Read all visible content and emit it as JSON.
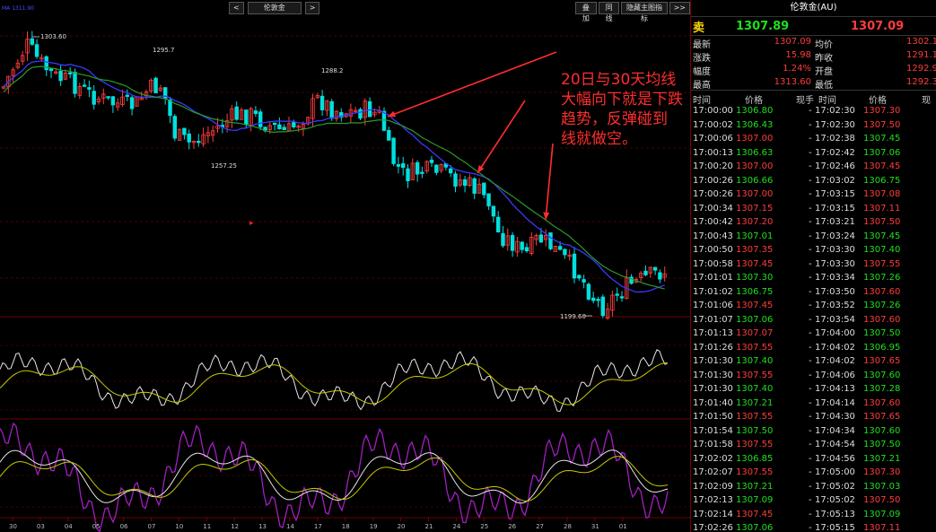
{
  "toolbar": {
    "prev_label": "<",
    "symbol_label": "伦敦金",
    "next_label": ">",
    "overlay_label": "叠加",
    "sync_label": "同线",
    "hide_indicators_label": "隐藏主图指标",
    "expand_label": ">>"
  },
  "main_chart": {
    "indicator_tag": "MA 1311.90",
    "high_label": "1303.60",
    "label_1": "1295.7",
    "label_2": "1288.2",
    "label_3": "1257.25",
    "low_label": "1199.60",
    "marker_glyph": "▸"
  },
  "annotation": {
    "lines": [
      "20日与30天均线",
      "大幅向下就是下跌",
      "趋势，反弹碰到",
      "线就做空。"
    ]
  },
  "x_axis_labels": [
    "30",
    "03",
    "04",
    "05",
    "06",
    "07",
    "10",
    "11",
    "12",
    "13",
    "14",
    "17",
    "18",
    "19",
    "20",
    "21",
    "24",
    "25",
    "26",
    "27",
    "28",
    "31",
    "01"
  ],
  "colors": {
    "up": "#ff3c3c",
    "down": "#00e0e0",
    "ma_blue": "#3a3aff",
    "ma_green": "#2a9a2a",
    "osc_white": "#e6e6e6",
    "osc_yellow": "#c8c800",
    "osc_purple": "#a020c0",
    "price_up": "#ff3c3c",
    "price_down": "#1ee01e",
    "annotation": "#ff2d2d"
  },
  "quote": {
    "title": "伦敦金(AU)",
    "sell_label": "卖",
    "sell_price": "1307.89",
    "buy_price": "1307.09",
    "stats": [
      {
        "l1": "最新",
        "v1": "1307.09",
        "l2": "均价",
        "v2": "1302.1"
      },
      {
        "l1": "涨跌",
        "v1": "15.98",
        "l2": "昨收",
        "v2": "1291.1"
      },
      {
        "l1": "幅度",
        "v1": "1.24%",
        "l2": "开盘",
        "v2": "1292.9"
      },
      {
        "l1": "最高",
        "v1": "1313.60",
        "l2": "最低",
        "v2": "1292.3"
      }
    ],
    "table_headers": {
      "time": "时间",
      "price": "价格",
      "vol": "现手",
      "time2": "时间",
      "price2": "价格",
      "vol2": "现"
    },
    "ticks": [
      {
        "t1": "17:00:00",
        "p1": "1306.80",
        "c1": "g",
        "t2": "17:02:30",
        "p2": "1307.30",
        "c2": "r"
      },
      {
        "t1": "17:00:02",
        "p1": "1306.43",
        "c1": "g",
        "t2": "17:02:30",
        "p2": "1307.50",
        "c2": "r"
      },
      {
        "t1": "17:00:06",
        "p1": "1307.00",
        "c1": "r",
        "t2": "17:02:38",
        "p2": "1307.45",
        "c2": "g"
      },
      {
        "t1": "17:00:13",
        "p1": "1306.63",
        "c1": "g",
        "t2": "17:02:42",
        "p2": "1307.06",
        "c2": "g"
      },
      {
        "t1": "17:00:20",
        "p1": "1307.00",
        "c1": "r",
        "t2": "17:02:46",
        "p2": "1307.45",
        "c2": "r"
      },
      {
        "t1": "17:00:26",
        "p1": "1306.66",
        "c1": "g",
        "t2": "17:03:02",
        "p2": "1306.75",
        "c2": "g"
      },
      {
        "t1": "17:00:26",
        "p1": "1307.00",
        "c1": "r",
        "t2": "17:03:15",
        "p2": "1307.08",
        "c2": "r"
      },
      {
        "t1": "17:00:34",
        "p1": "1307.15",
        "c1": "r",
        "t2": "17:03:15",
        "p2": "1307.11",
        "c2": "r"
      },
      {
        "t1": "17:00:42",
        "p1": "1307.20",
        "c1": "r",
        "t2": "17:03:21",
        "p2": "1307.50",
        "c2": "r"
      },
      {
        "t1": "17:00:43",
        "p1": "1307.01",
        "c1": "g",
        "t2": "17:03:24",
        "p2": "1307.45",
        "c2": "g"
      },
      {
        "t1": "17:00:50",
        "p1": "1307.35",
        "c1": "r",
        "t2": "17:03:30",
        "p2": "1307.40",
        "c2": "g"
      },
      {
        "t1": "17:00:58",
        "p1": "1307.45",
        "c1": "r",
        "t2": "17:03:30",
        "p2": "1307.55",
        "c2": "r"
      },
      {
        "t1": "17:01:01",
        "p1": "1307.30",
        "c1": "g",
        "t2": "17:03:34",
        "p2": "1307.26",
        "c2": "g"
      },
      {
        "t1": "17:01:02",
        "p1": "1306.75",
        "c1": "g",
        "t2": "17:03:50",
        "p2": "1307.60",
        "c2": "r"
      },
      {
        "t1": "17:01:06",
        "p1": "1307.45",
        "c1": "r",
        "t2": "17:03:52",
        "p2": "1307.26",
        "c2": "g"
      },
      {
        "t1": "17:01:07",
        "p1": "1307.06",
        "c1": "g",
        "t2": "17:03:54",
        "p2": "1307.60",
        "c2": "r"
      },
      {
        "t1": "17:01:13",
        "p1": "1307.07",
        "c1": "r",
        "t2": "17:04:00",
        "p2": "1307.50",
        "c2": "g"
      },
      {
        "t1": "17:01:26",
        "p1": "1307.55",
        "c1": "r",
        "t2": "17:04:02",
        "p2": "1306.95",
        "c2": "g"
      },
      {
        "t1": "17:01:30",
        "p1": "1307.40",
        "c1": "g",
        "t2": "17:04:02",
        "p2": "1307.65",
        "c2": "r"
      },
      {
        "t1": "17:01:30",
        "p1": "1307.55",
        "c1": "r",
        "t2": "17:04:06",
        "p2": "1307.60",
        "c2": "g"
      },
      {
        "t1": "17:01:30",
        "p1": "1307.40",
        "c1": "g",
        "t2": "17:04:13",
        "p2": "1307.28",
        "c2": "g"
      },
      {
        "t1": "17:01:40",
        "p1": "1307.21",
        "c1": "g",
        "t2": "17:04:14",
        "p2": "1307.60",
        "c2": "r"
      },
      {
        "t1": "17:01:50",
        "p1": "1307.55",
        "c1": "r",
        "t2": "17:04:30",
        "p2": "1307.65",
        "c2": "r"
      },
      {
        "t1": "17:01:54",
        "p1": "1307.50",
        "c1": "g",
        "t2": "17:04:34",
        "p2": "1307.60",
        "c2": "g"
      },
      {
        "t1": "17:01:58",
        "p1": "1307.55",
        "c1": "r",
        "t2": "17:04:54",
        "p2": "1307.50",
        "c2": "g"
      },
      {
        "t1": "17:02:02",
        "p1": "1306.85",
        "c1": "g",
        "t2": "17:04:56",
        "p2": "1307.21",
        "c2": "g"
      },
      {
        "t1": "17:02:07",
        "p1": "1307.55",
        "c1": "r",
        "t2": "17:05:00",
        "p2": "1307.30",
        "c2": "r"
      },
      {
        "t1": "17:02:09",
        "p1": "1307.21",
        "c1": "g",
        "t2": "17:05:02",
        "p2": "1307.03",
        "c2": "g"
      },
      {
        "t1": "17:02:13",
        "p1": "1307.09",
        "c1": "g",
        "t2": "17:05:02",
        "p2": "1307.50",
        "c2": "r"
      },
      {
        "t1": "17:02:14",
        "p1": "1307.45",
        "c1": "r",
        "t2": "17:05:13",
        "p2": "1307.09",
        "c2": "g"
      },
      {
        "t1": "17:02:26",
        "p1": "1307.06",
        "c1": "g",
        "t2": "17:05:15",
        "p2": "1307.11",
        "c2": "r"
      }
    ]
  }
}
